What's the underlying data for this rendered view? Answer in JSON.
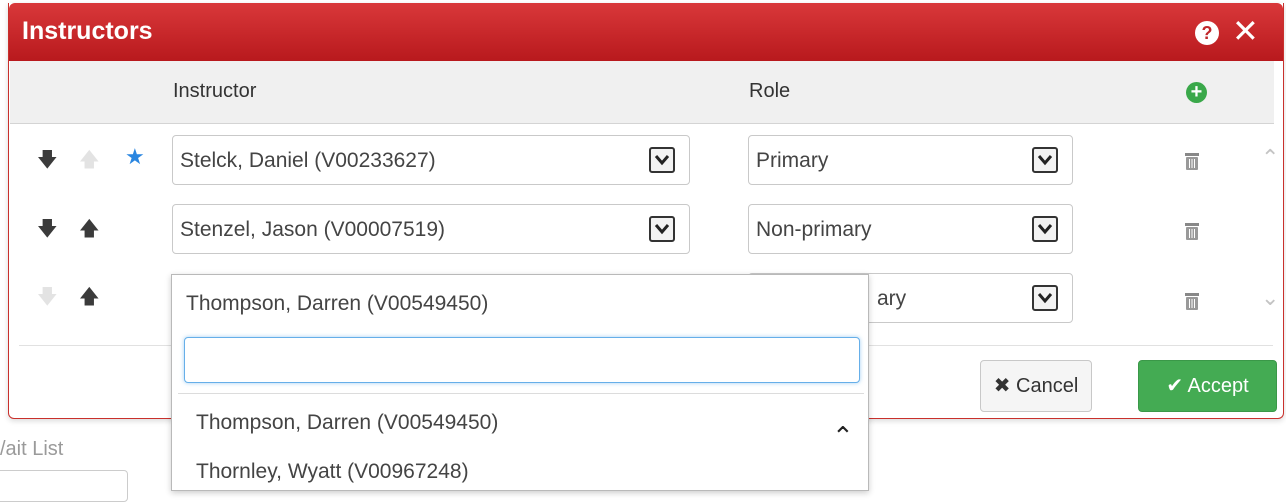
{
  "dialog": {
    "title": "Instructors",
    "help_icon": "?",
    "close_icon": "✕"
  },
  "table": {
    "col_instructor": "Instructor",
    "col_role": "Role",
    "add_icon": "+",
    "rows": [
      {
        "instructor": "Stelck, Daniel (V00233627)",
        "role": "Primary"
      },
      {
        "instructor": "Stenzel, Jason (V00007519)",
        "role": "Non-primary"
      },
      {
        "instructor": "Thompson, Darren (V00549450)",
        "role": "ary"
      }
    ]
  },
  "buttons": {
    "cancel": "Cancel",
    "accept": "Accept"
  },
  "dropdown": {
    "selected": "Thompson, Darren (V00549450)",
    "search_value": "",
    "options": [
      "Thompson, Darren (V00549450)",
      "Thornley, Wyatt (V00967248)"
    ]
  },
  "background": {
    "wait_list_label": "/ait List"
  },
  "colors": {
    "titlebar": "#c62a2e",
    "accept": "#44ab53",
    "star": "#2a86e0"
  }
}
